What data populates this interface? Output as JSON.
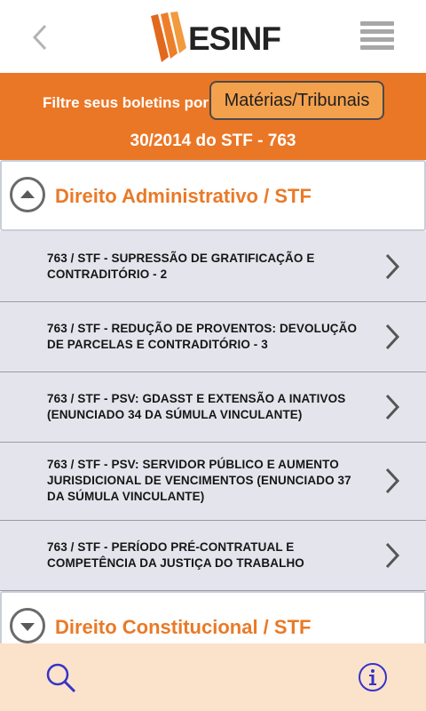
{
  "header": {
    "logo_text": "ESINF",
    "back_icon": "chevron-left-icon",
    "menu_icon": "hamburger-menu-icon"
  },
  "filter": {
    "label": "Filtre seus boletins por:",
    "selected": "Matérias/Tribunais",
    "issue_title": "30/2014 do STF - 763"
  },
  "sections": [
    {
      "title": "Direito Administrativo / STF",
      "state": "expanded",
      "toggle_icon": "collapse-arrow-up-icon"
    },
    {
      "title": "Direito Constitucional / STF",
      "state": "collapsed",
      "toggle_icon": "expand-arrow-down-icon"
    }
  ],
  "items": [
    {
      "lines": [
        "763 / STF - SUPRESSÃO DE GRATIFICAÇÃO E",
        "CONTRADITÓRIO - 2"
      ]
    },
    {
      "lines": [
        "763 / STF - REDUÇÃO DE PROVENTOS: DEVOLUÇÃO",
        "DE PARCELAS E CONTRADITÓRIO - 3"
      ]
    },
    {
      "lines": [
        "763 / STF - PSV: GDASST E EXTENSÃO A INATIVOS",
        "(ENUNCIADO 34 DA SÚMULA VINCULANTE)"
      ]
    },
    {
      "lines": [
        "763 / STF - PSV: SERVIDOR PÚBLICO E AUMENTO",
        "JURISDICIONAL DE VENCIMENTOS (ENUNCIADO 37",
        "DA SÚMULA VINCULANTE)"
      ]
    },
    {
      "lines": [
        "763 / STF - PERÍODO PRÉ-CONTRATUAL E",
        "COMPETÊNCIA DA JUSTIÇA DO TRABALHO"
      ]
    }
  ],
  "footer": {
    "search_icon": "search-icon",
    "info_icon": "info-icon"
  },
  "colors": {
    "accent_orange": "#ea7726",
    "section_title": "#e97a27",
    "footer_bg": "#fbe2cb",
    "icon_blue": "#3434c9"
  }
}
